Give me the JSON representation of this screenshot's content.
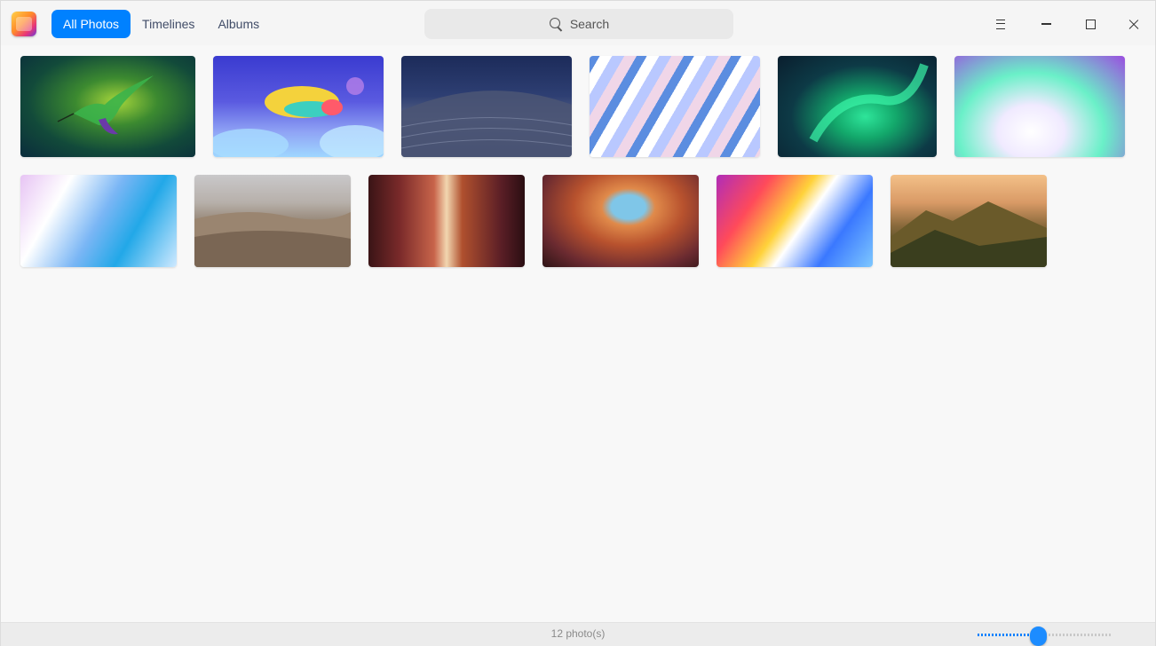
{
  "app": {
    "logo_icon": "photos-app-icon"
  },
  "tabs": [
    {
      "label": "All Photos",
      "active": true
    },
    {
      "label": "Timelines",
      "active": false
    },
    {
      "label": "Albums",
      "active": false
    }
  ],
  "search": {
    "placeholder": "Search",
    "icon": "search-icon"
  },
  "window_controls": [
    "menu-icon",
    "minimize-icon",
    "maximize-icon",
    "close-icon"
  ],
  "photos": [
    {
      "name": "hummingbird"
    },
    {
      "name": "whale"
    },
    {
      "name": "dunes-night"
    },
    {
      "name": "light-rays"
    },
    {
      "name": "aurora"
    },
    {
      "name": "aurora-pastel"
    },
    {
      "name": "soft-wave"
    },
    {
      "name": "desert"
    },
    {
      "name": "canyon"
    },
    {
      "name": "arch"
    },
    {
      "name": "prism"
    },
    {
      "name": "mountains"
    }
  ],
  "status": {
    "count_text": "12 photo(s)"
  },
  "zoom_slider": {
    "value": 0.45
  },
  "colors": {
    "accent": "#0081ff",
    "background": "#f8f8f8"
  }
}
